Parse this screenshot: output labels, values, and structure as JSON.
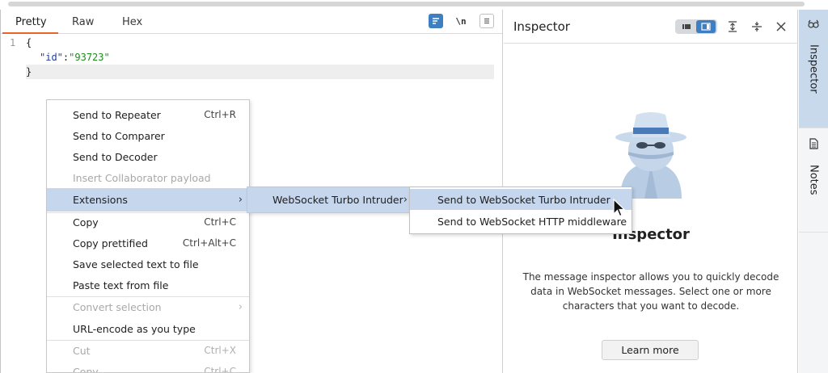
{
  "editor": {
    "tabs": [
      "Pretty",
      "Raw",
      "Hex"
    ],
    "active_tab": "Pretty",
    "toolbar": {
      "newline_label": "\\n"
    },
    "line_number": "1",
    "code": {
      "open_brace": "{",
      "key": "\"id\"",
      "colon": ":",
      "value": "\"93723\"",
      "close_brace": "}"
    }
  },
  "context_menu": {
    "items": [
      {
        "label": "Send to Repeater",
        "shortcut": "Ctrl+R"
      },
      {
        "label": "Send to Comparer",
        "shortcut": ""
      },
      {
        "label": "Send to Decoder",
        "shortcut": ""
      },
      {
        "label": "Insert Collaborator payload",
        "shortcut": "",
        "disabled": true
      },
      {
        "label": "Extensions",
        "submenu": true,
        "highlighted": true
      },
      {
        "label": "Copy",
        "shortcut": "Ctrl+C"
      },
      {
        "label": "Copy prettified",
        "shortcut": "Ctrl+Alt+C"
      },
      {
        "label": "Save selected text to file",
        "shortcut": ""
      },
      {
        "label": "Paste text from file",
        "shortcut": ""
      },
      {
        "label": "Convert selection",
        "submenu": true,
        "disabled": true
      },
      {
        "label": "URL-encode as you type",
        "shortcut": ""
      },
      {
        "label": "Cut",
        "shortcut": "Ctrl+X",
        "disabled": true
      },
      {
        "label": "Copy",
        "shortcut": "Ctrl+C",
        "disabled": true
      }
    ],
    "extensions_submenu": {
      "label": "WebSocket Turbo Intruder"
    },
    "turbo_submenu": {
      "items": [
        "Send to WebSocket Turbo Intruder",
        "Send to WebSocket HTTP middleware"
      ]
    }
  },
  "inspector": {
    "title": "Inspector",
    "heading": "Inspector",
    "description": "The message inspector allows you to quickly decode data in WebSocket messages. Select one or more characters that you want to decode.",
    "learn_more": "Learn more"
  },
  "side_tabs": [
    "Inspector",
    "Notes"
  ],
  "colors": {
    "accent": "#e8652a",
    "highlight": "#c6d6ec",
    "primary_blue": "#3d7fc1",
    "json_value": "#1a8f1a",
    "json_key": "#1f3c9c"
  }
}
